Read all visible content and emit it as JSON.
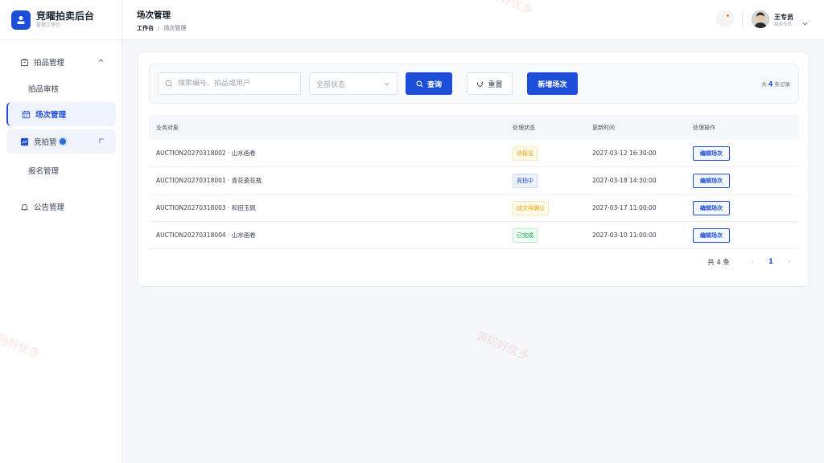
{
  "brand": {
    "title": "竞曜拍卖后台",
    "subtitle": "管理工作台"
  },
  "sidebar": {
    "items": [
      {
        "label": "拍品管理",
        "icon": "box-icon"
      },
      {
        "label": "拍品审核"
      },
      {
        "label": "场次管理",
        "icon": "calendar-icon"
      },
      {
        "label": "竞拍管",
        "icon": "chart-icon"
      },
      {
        "label": "报名管理"
      },
      {
        "label": "公告管理",
        "icon": "bell-icon"
      }
    ]
  },
  "header": {
    "title": "场次管理",
    "breadcrumb": {
      "home": "工作台",
      "separator": "/",
      "current": "场次管理"
    },
    "user": {
      "name": "王专员",
      "role": "拍卖专员"
    }
  },
  "filters": {
    "search_placeholder": "搜索编号、拍品或用户",
    "status_placeholder": "全部状态",
    "query_label": "查询",
    "reset_label": "重置",
    "add_label": "新增场次",
    "total_prefix": "共",
    "total_count": "4",
    "total_suffix": "条记录"
  },
  "table": {
    "headers": [
      "业务对象",
      "处理状态",
      "更新时间",
      "处理操作"
    ],
    "rows": [
      {
        "object": "AUCTION20270318002 · 山水画卷",
        "status": "待报名",
        "time": "2027-03-12 16:30:00",
        "action": "编辑场次"
      },
      {
        "object": "AUCTION20270318001 · 青花瓷花瓶",
        "status": "竞拍中",
        "time": "2027-03-18 14:30:00",
        "action": "编辑场次"
      },
      {
        "object": "AUCTION20270318003 · 和田玉佩",
        "status": "成交待确认",
        "time": "2027-03-17 11:00:00",
        "action": "编辑场次"
      },
      {
        "object": "AUCTION20270318004 · 山水画卷",
        "status": "已完成",
        "time": "2027-03-10 11:00:00",
        "action": "编辑场次"
      }
    ]
  },
  "pagination": {
    "total_label": "共 4 条",
    "prev": "‹",
    "current": "1",
    "next": "›"
  },
  "watermark": "源码好优多",
  "colors": {
    "primary": "#1d4ed8",
    "pending": "#f59e0b",
    "active": "#1d4ed8",
    "done": "#16a34a"
  }
}
